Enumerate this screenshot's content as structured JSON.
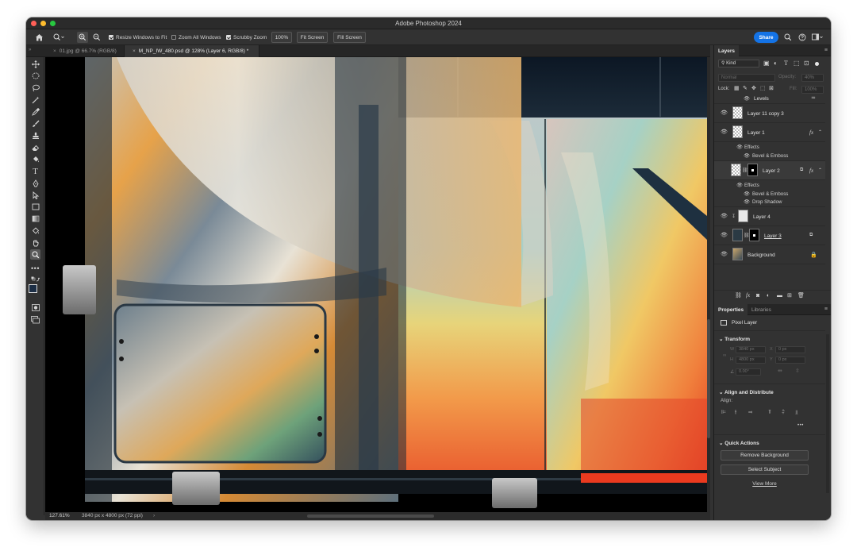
{
  "window": {
    "title": "Adobe Photoshop 2024"
  },
  "options_bar": {
    "resize_windows": "Resize Windows to Fit",
    "zoom_all": "Zoom All Windows",
    "scrubby_zoom": "Scrubby Zoom",
    "zoom_value": "100%",
    "fit_screen": "Fit Screen",
    "fill_screen": "Fill Screen",
    "share": "Share",
    "resize_checked": true,
    "zoom_all_checked": false,
    "scrubby_checked": true
  },
  "tabs": [
    {
      "label": "01.jpg @ 66.7% (RGB/8)"
    },
    {
      "label": "M_NP_IW_480.psd @ 128% (Layer 6, RGB/8) *"
    }
  ],
  "status": {
    "zoom": "127.61%",
    "doc_info": "3840 px x 4800 px (72 ppi)"
  },
  "layers_panel": {
    "tab_label": "Layers",
    "kind_label": "Kind",
    "blend_mode": "Normal",
    "opacity_label": "Opacity:",
    "opacity_value": "40%",
    "lock_label": "Lock:",
    "fill_label": "Fill:",
    "fill_value": "100%",
    "layers": [
      {
        "name": "Levels"
      },
      {
        "name": "Layer 11 copy 3"
      },
      {
        "name": "Layer 1",
        "effects_label": "Effects",
        "effects": [
          "Bevel & Emboss"
        ]
      },
      {
        "name": "Layer 2",
        "effects_label": "Effects",
        "effects": [
          "Bevel & Emboss",
          "Drop Shadow"
        ]
      },
      {
        "name": "Layer 4"
      },
      {
        "name": "Layer 3"
      },
      {
        "name": "Background"
      }
    ]
  },
  "properties_panel": {
    "tab_properties": "Properties",
    "tab_libraries": "Libraries",
    "type_label": "Pixel Layer",
    "transform": {
      "title": "Transform",
      "w_label": "W",
      "w_value": "3840 px",
      "x_label": "X",
      "x_value": "0 px",
      "h_label": "H",
      "h_value": "4800 px",
      "y_label": "Y",
      "y_value": "0 px",
      "angle_value": "0.00°"
    },
    "align": {
      "title": "Align and Distribute",
      "align_label": "Align:"
    },
    "quick_actions": {
      "title": "Quick Actions",
      "remove_bg": "Remove Background",
      "select_subject": "Select Subject",
      "view_more": "View More"
    }
  },
  "colors": {
    "accent": "#1473e6",
    "panel_bg": "#323232",
    "tab_bg": "#262626"
  }
}
